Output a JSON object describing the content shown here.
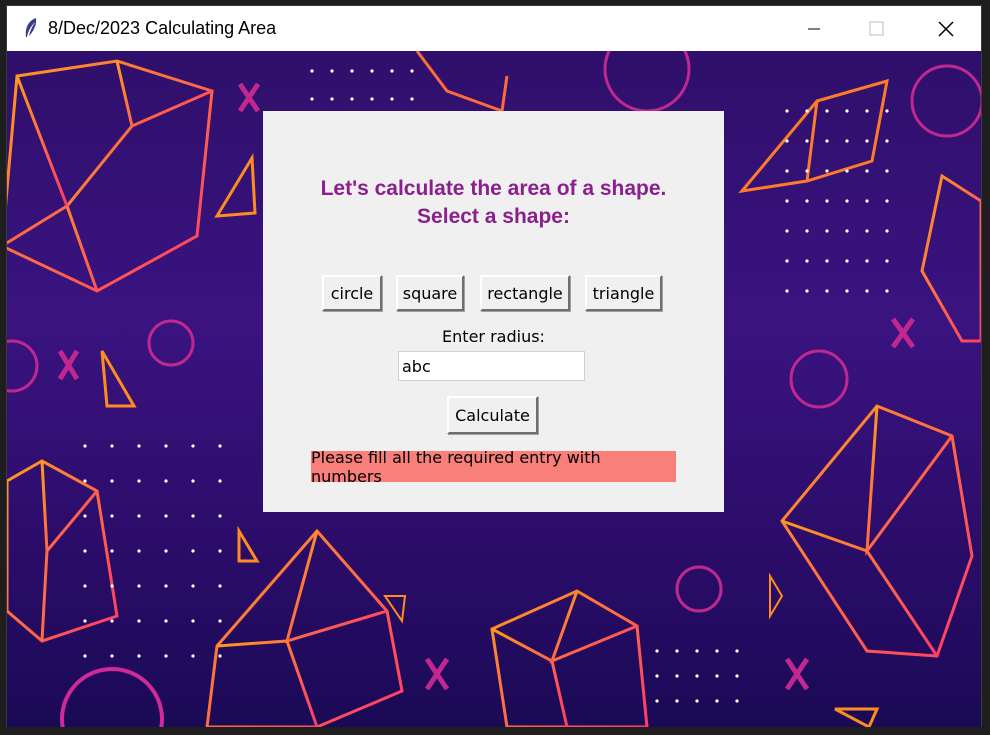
{
  "window": {
    "title": "8/Dec/2023 Calculating Area",
    "title_icon": "feather-icon",
    "controls": [
      "minimize-icon",
      "maximize-icon",
      "close-icon"
    ]
  },
  "app": {
    "heading": "Let's calculate the area of a shape.\nSelect a shape:",
    "heading_line1": "Let's calculate the area of a shape.",
    "heading_line2": "Select a shape:",
    "shape_buttons": [
      "circle",
      "square",
      "rectangle",
      "triangle"
    ],
    "entry_label": "Enter radius:",
    "entry_value": "abc",
    "calculate_label": "Calculate",
    "error_message": "Please fill all the required entry with numbers"
  },
  "colors": {
    "heading": "#8b1f8e",
    "error_bg": "#f87f7a",
    "panel_bg": "#f0f0f0",
    "background_purple": "#3a1380",
    "accent_orange": "#f07a2a",
    "accent_magenta": "#d02a9a"
  }
}
